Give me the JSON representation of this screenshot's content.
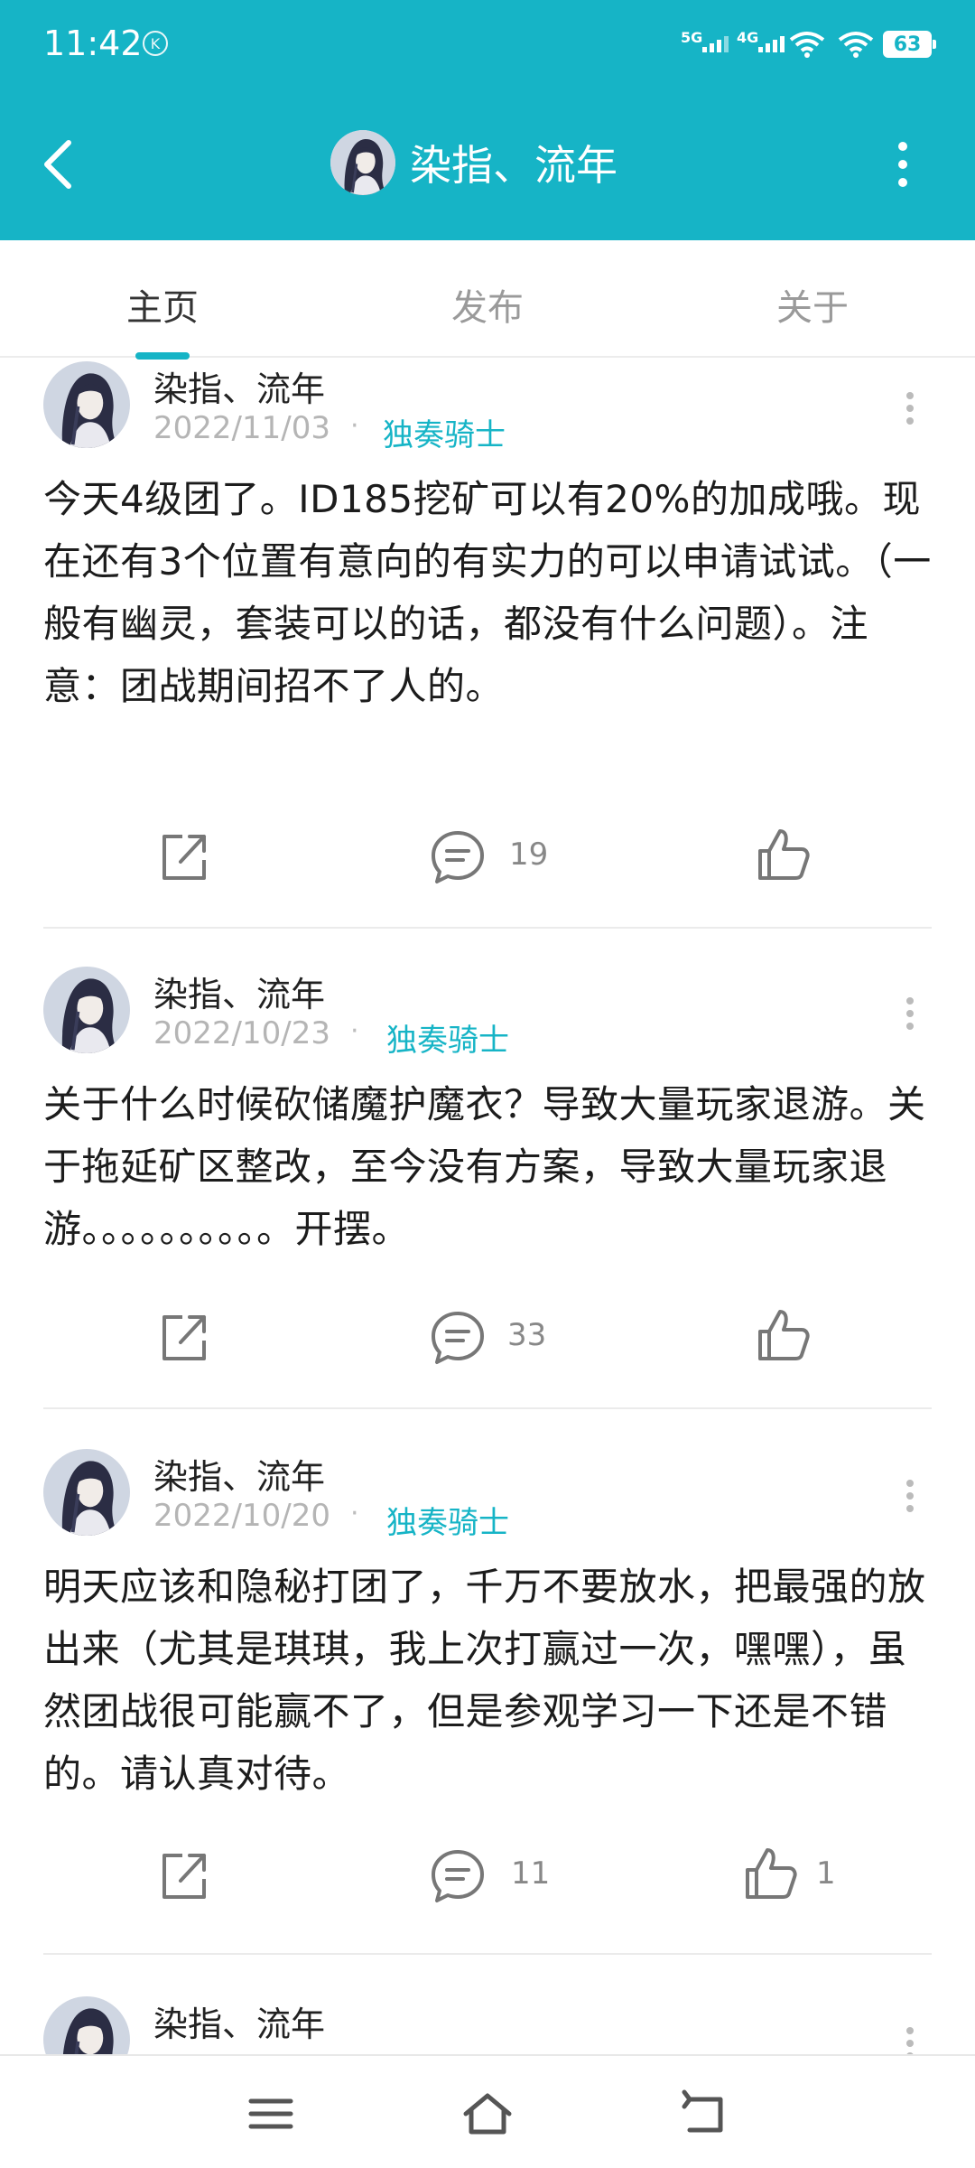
{
  "status_bar": {
    "time": "11:42",
    "k_icon": "K",
    "net1": "5G",
    "net2": "4G",
    "battery": "63"
  },
  "header": {
    "title": "染指、流年"
  },
  "tabs": [
    {
      "label": "主页",
      "active": true
    },
    {
      "label": "发布",
      "active": false
    },
    {
      "label": "关于",
      "active": false
    }
  ],
  "posts": [
    {
      "author": "染指、流年",
      "date": "2022/11/03",
      "separator": "·",
      "badge": "独奏骑士",
      "body": "今天4级团了。ID185挖矿可以有20%的加成哦。现在还有3个位置有意向的有实力的可以申请试试。（一般有幽灵，套装可以的话，都没有什么问题）。注意：团战期间招不了人的。",
      "comments": "19",
      "likes": ""
    },
    {
      "author": "染指、流年",
      "date": "2022/10/23",
      "separator": "·",
      "badge": "独奏骑士",
      "body": "关于什么时候砍储魔护魔衣？导致大量玩家退游。关于拖延矿区整改，至今没有方案，导致大量玩家退游。。。。。。。。。。开摆。",
      "comments": "33",
      "likes": ""
    },
    {
      "author": "染指、流年",
      "date": "2022/10/20",
      "separator": "·",
      "badge": "独奏骑士",
      "body": "明天应该和隐秘打团了，千万不要放水，把最强的放出来（尤其是琪琪，我上次打赢过一次，嘿嘿），虽然团战很可能赢不了，但是参观学习一下还是不错的。请认真对待。",
      "comments": "11",
      "likes": "1"
    },
    {
      "author": "染指、流年"
    }
  ],
  "icons": {
    "back": "back-arrow-icon",
    "more": "more-vertical-icon",
    "share": "share-icon",
    "comment": "comment-icon",
    "like": "thumbs-up-icon",
    "menu": "menu-icon",
    "home": "home-icon",
    "return": "back-nav-icon"
  },
  "colors": {
    "accent": "#16b4c6",
    "muted": "#b5b5b5"
  }
}
